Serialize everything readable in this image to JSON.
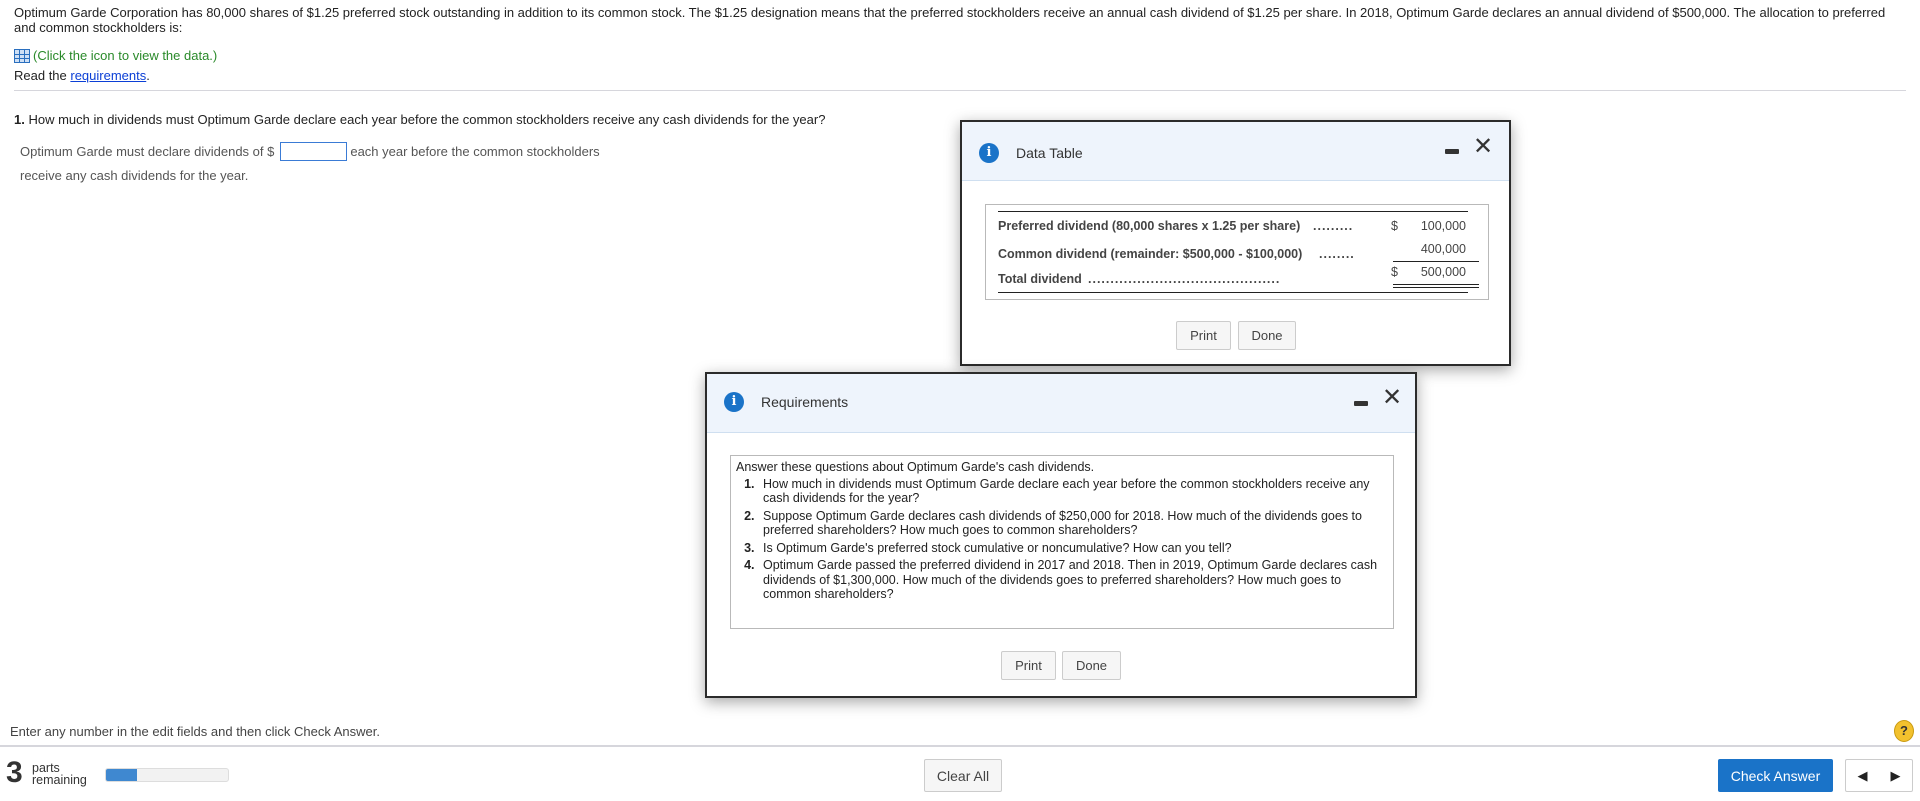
{
  "problem": {
    "intro": "Optimum Garde Corporation has 80,000 shares of $1.25 preferred stock outstanding in addition to its common stock. The $1.25 designation means that the preferred stockholders receive an annual cash dividend of $1.25 per share. In 2018, Optimum Garde declares an annual dividend of $500,000. The allocation to preferred and common stockholders is:",
    "data_link": "(Click the icon to view the data.)",
    "read_prefix": "Read the ",
    "requirements_link": "requirements",
    "read_suffix": "."
  },
  "question": {
    "number": "1.",
    "text": " How much in dividends must Optimum Garde declare each year before the common stockholders receive any cash dividends for the year?",
    "answer_prefix": "Optimum Garde must declare dividends of $",
    "answer_value": "",
    "answer_suffix": "each year before the common stockholders",
    "answer_line2": "receive any cash dividends for the year."
  },
  "data_table": {
    "title": "Data Table",
    "rows": [
      {
        "label": "Preferred dividend (80,000 shares x 1.25 per share)",
        "dots": ".........",
        "currency": "$",
        "value": "100,000"
      },
      {
        "label": "Common dividend (remainder: $500,000 - $100,000)",
        "dots": "........",
        "currency": "",
        "value": "400,000"
      },
      {
        "label": "Total dividend",
        "dots": "...........................................",
        "currency": "$",
        "value": "500,000"
      }
    ],
    "print": "Print",
    "done": "Done"
  },
  "requirements": {
    "title": "Requirements",
    "intro": "Answer these questions about Optimum Garde's cash dividends.",
    "items": [
      "How much in dividends must Optimum Garde declare each year before the common stockholders receive any cash dividends for the year?",
      "Suppose Optimum Garde declares cash dividends of $250,000 for 2018. How much of the dividends goes to preferred shareholders? How much goes to common shareholders?",
      "Is Optimum Garde's preferred stock cumulative or noncumulative? How can you tell?",
      "Optimum Garde passed the preferred dividend in 2017 and 2018. Then in 2019, Optimum Garde declares cash dividends of $1,300,000. How much of the dividends goes to preferred shareholders? How much goes to common shareholders?"
    ],
    "print": "Print",
    "done": "Done"
  },
  "footer": {
    "instruction": "Enter any number in the edit fields and then click Check Answer.",
    "parts_count": "3",
    "parts_label1": "parts",
    "parts_label2": "remaining",
    "progress_fraction": 0.25,
    "clear_all": "Clear All",
    "check_answer": "Check Answer",
    "help": "?"
  },
  "colors": {
    "accent": "#1a73c8",
    "link": "#0b3fd6",
    "data_link": "#2a8a2a",
    "check_answer": "#1a73c8",
    "help": "#f2c12e"
  }
}
